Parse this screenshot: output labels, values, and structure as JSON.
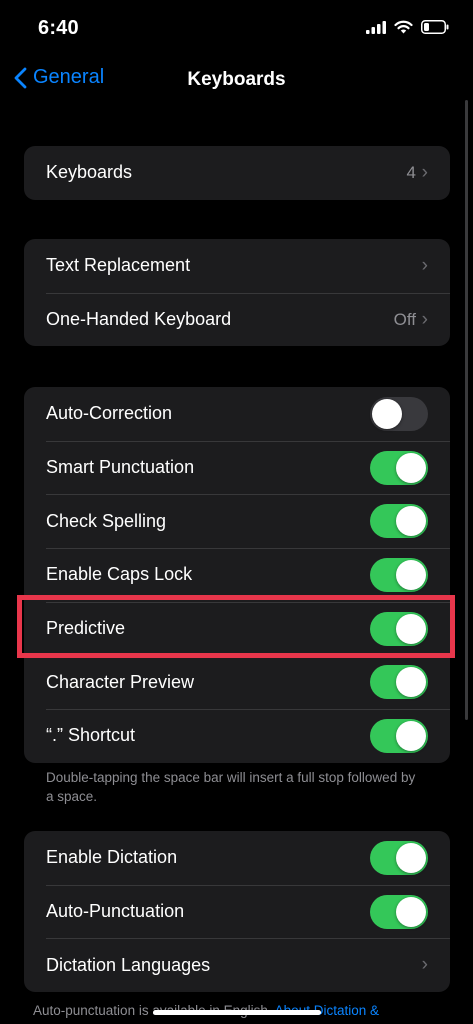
{
  "status": {
    "time": "6:40"
  },
  "nav": {
    "back_label": "General",
    "title": "Keyboards"
  },
  "keyboards_group": {
    "label": "Keyboards",
    "value": "4"
  },
  "text_group": [
    {
      "label": "Text Replacement",
      "value": ""
    },
    {
      "label": "One-Handed Keyboard",
      "value": "Off"
    }
  ],
  "toggles_group": [
    {
      "label": "Auto-Correction",
      "on": false
    },
    {
      "label": "Smart Punctuation",
      "on": true
    },
    {
      "label": "Check Spelling",
      "on": true
    },
    {
      "label": "Enable Caps Lock",
      "on": true
    },
    {
      "label": "Predictive",
      "on": true
    },
    {
      "label": "Character Preview",
      "on": true
    },
    {
      "label": "“.” Shortcut",
      "on": true
    }
  ],
  "shortcut_footnote": "Double-tapping the space bar will insert a full stop followed by a space.",
  "dictation_group": [
    {
      "label": "Enable Dictation",
      "on": true
    },
    {
      "label": "Auto-Punctuation",
      "on": true
    },
    {
      "label": "Dictation Languages"
    }
  ],
  "dictation_footnote": {
    "text": "Auto-punctuation is available in English.",
    "link": "About Dictation &"
  },
  "colors": {
    "accent": "#0a84ff",
    "toggle_on": "#34c759",
    "highlight": "#e8364b",
    "background": "#000000",
    "cell": "#1c1c1e"
  }
}
